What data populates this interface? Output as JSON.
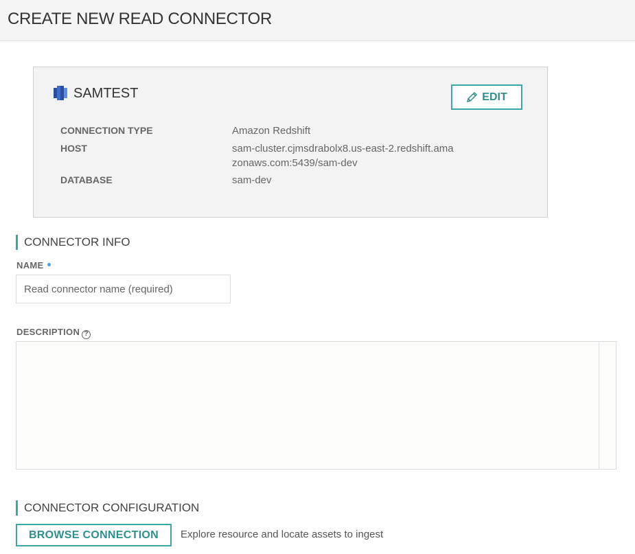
{
  "header": {
    "title": "CREATE NEW READ CONNECTOR"
  },
  "connection": {
    "name": "SAMTEST",
    "icon": "amazon-redshift-icon",
    "edit_label": "EDIT",
    "rows": [
      {
        "label": "CONNECTION TYPE",
        "value": "Amazon Redshift"
      },
      {
        "label": "HOST",
        "value": "sam-cluster.cjmsdrabolx8.us-east-2.redshift.amazonaws.com:5439/sam-dev"
      },
      {
        "label": "DATABASE",
        "value": "sam-dev"
      }
    ]
  },
  "connector_info": {
    "title": "CONNECTOR INFO",
    "name_label": "NAME",
    "name_placeholder": "Read connector name (required)",
    "name_value": "",
    "description_label": "DESCRIPTION",
    "description_help_icon": "?",
    "description_value": ""
  },
  "connector_config": {
    "title": "CONNECTOR CONFIGURATION",
    "browse_label": "BROWSE CONNECTION",
    "browse_hint": "Explore resource and locate assets to ingest"
  },
  "colors": {
    "accent": "#3aa8a8",
    "required_dot": "#4aa3df"
  }
}
